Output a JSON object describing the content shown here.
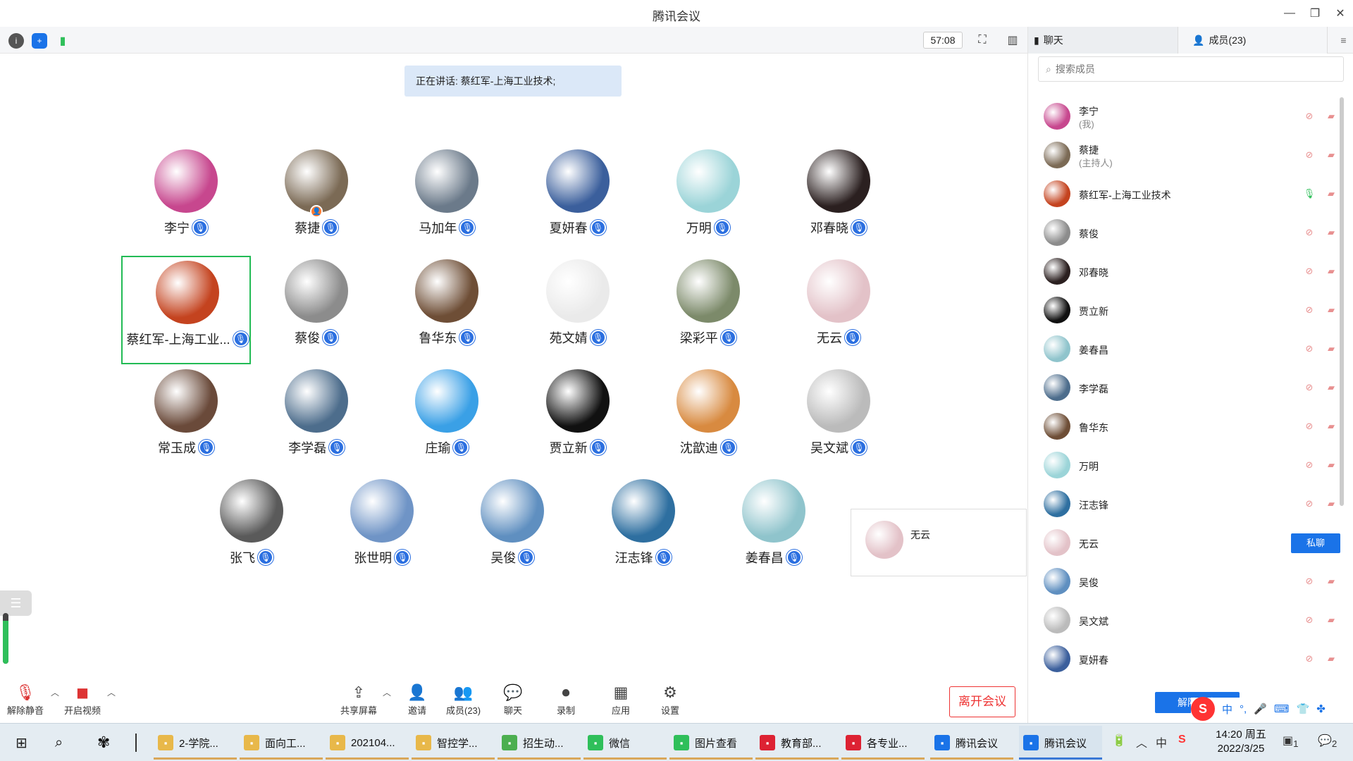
{
  "window": {
    "title": "腾讯会议"
  },
  "toolbar": {
    "timer": "57:08"
  },
  "speaking": "正在讲话: 蔡红军-上海工业技术;",
  "grid": [
    {
      "name": "李宁",
      "color": "#c7478e"
    },
    {
      "name": "蔡捷",
      "color": "#7b6a55",
      "host": true
    },
    {
      "name": "马加年",
      "color": "#6b7a8a"
    },
    {
      "name": "夏妍春",
      "color": "#3b5f9c"
    },
    {
      "name": "万明",
      "color": "#9bd4d8"
    },
    {
      "name": "邓春晓",
      "color": "#2b2020"
    },
    {
      "name": "蔡红军-上海工业...",
      "color": "#c4431f",
      "active": true
    },
    {
      "name": "蔡俊",
      "color": "#8c8c8c"
    },
    {
      "name": "鲁华东",
      "color": "#6e4e36"
    },
    {
      "name": "苑文婧",
      "color": "#eaeaea"
    },
    {
      "name": "梁彩平",
      "color": "#7c8a6a"
    },
    {
      "name": "无云",
      "color": "#e3c2c8"
    },
    {
      "name": "常玉成",
      "color": "#6a4a3a"
    },
    {
      "name": "李学磊",
      "color": "#4d6d8c"
    },
    {
      "name": "庄瑜",
      "color": "#3aa0e6"
    },
    {
      "name": "贾立新",
      "color": "#111111"
    },
    {
      "name": "沈歆迪",
      "color": "#d88a40"
    },
    {
      "name": "吴文斌",
      "color": "#bbbbbb"
    },
    {
      "name": "张飞",
      "color": "#5a5a5a"
    },
    {
      "name": "张世明",
      "color": "#6f94c6"
    },
    {
      "name": "吴俊",
      "color": "#5f8fc0"
    },
    {
      "name": "汪志锋",
      "color": "#2e6fa0"
    },
    {
      "name": "姜春昌",
      "color": "#8fc4cc"
    }
  ],
  "popcard": {
    "name": "无云"
  },
  "bottombar": {
    "unmute": "解除静音",
    "video": "开启视频",
    "share": "共享屏幕",
    "invite": "邀请",
    "members": "成员(23)",
    "chat": "聊天",
    "record": "录制",
    "apps": "应用",
    "settings": "设置",
    "leave": "离开会议"
  },
  "panel": {
    "tab_chat": "聊天",
    "tab_members": "成员(23)",
    "search_placeholder": "搜索成员",
    "members": [
      {
        "name": "李宁",
        "role": "(我)",
        "color": "#c7478e"
      },
      {
        "name": "蔡捷",
        "role": "(主持人)",
        "color": "#7b6a55"
      },
      {
        "name": "蔡红军-上海工业技术",
        "color": "#c4431f",
        "mic_on": true
      },
      {
        "name": "蔡俊",
        "color": "#8c8c8c"
      },
      {
        "name": "邓春晓",
        "color": "#2b2020"
      },
      {
        "name": "贾立新",
        "color": "#111111"
      },
      {
        "name": "姜春昌",
        "color": "#8fc4cc"
      },
      {
        "name": "李学磊",
        "color": "#4d6d8c"
      },
      {
        "name": "鲁华东",
        "color": "#6e4e36"
      },
      {
        "name": "万明",
        "color": "#9bd4d8"
      },
      {
        "name": "汪志锋",
        "color": "#2e6fa0"
      },
      {
        "name": "无云",
        "color": "#e3c2c8",
        "pm": "私聊"
      },
      {
        "name": "吴俊",
        "color": "#5f8fc0"
      },
      {
        "name": "吴文斌",
        "color": "#bbbbbb"
      },
      {
        "name": "夏妍春",
        "color": "#3b5f9c"
      }
    ],
    "unmute_all": "解除静音"
  },
  "ime": {
    "lang": "中"
  },
  "taskbar": {
    "items": [
      {
        "label": "2-学院...",
        "color": "#e8b84a"
      },
      {
        "label": "面向工...",
        "color": "#e8b84a"
      },
      {
        "label": "202104...",
        "color": "#e8b84a"
      },
      {
        "label": "智控学...",
        "color": "#e8b84a"
      },
      {
        "label": "招生动...",
        "color": "#4caf50"
      },
      {
        "label": "微信",
        "color": "#2fbf5a"
      },
      {
        "label": "图片查看",
        "color": "#2fbf5a"
      },
      {
        "label": "教育部...",
        "color": "#d23"
      },
      {
        "label": "各专业...",
        "color": "#d23"
      },
      {
        "label": "腾讯会议",
        "color": "#1a73e8"
      },
      {
        "label": "腾讯会议",
        "color": "#1a73e8"
      }
    ],
    "time": "14:20 周五",
    "date": "2022/3/25",
    "notif_count": "2",
    "tray_count": "1"
  },
  "mic_level": 0.85
}
